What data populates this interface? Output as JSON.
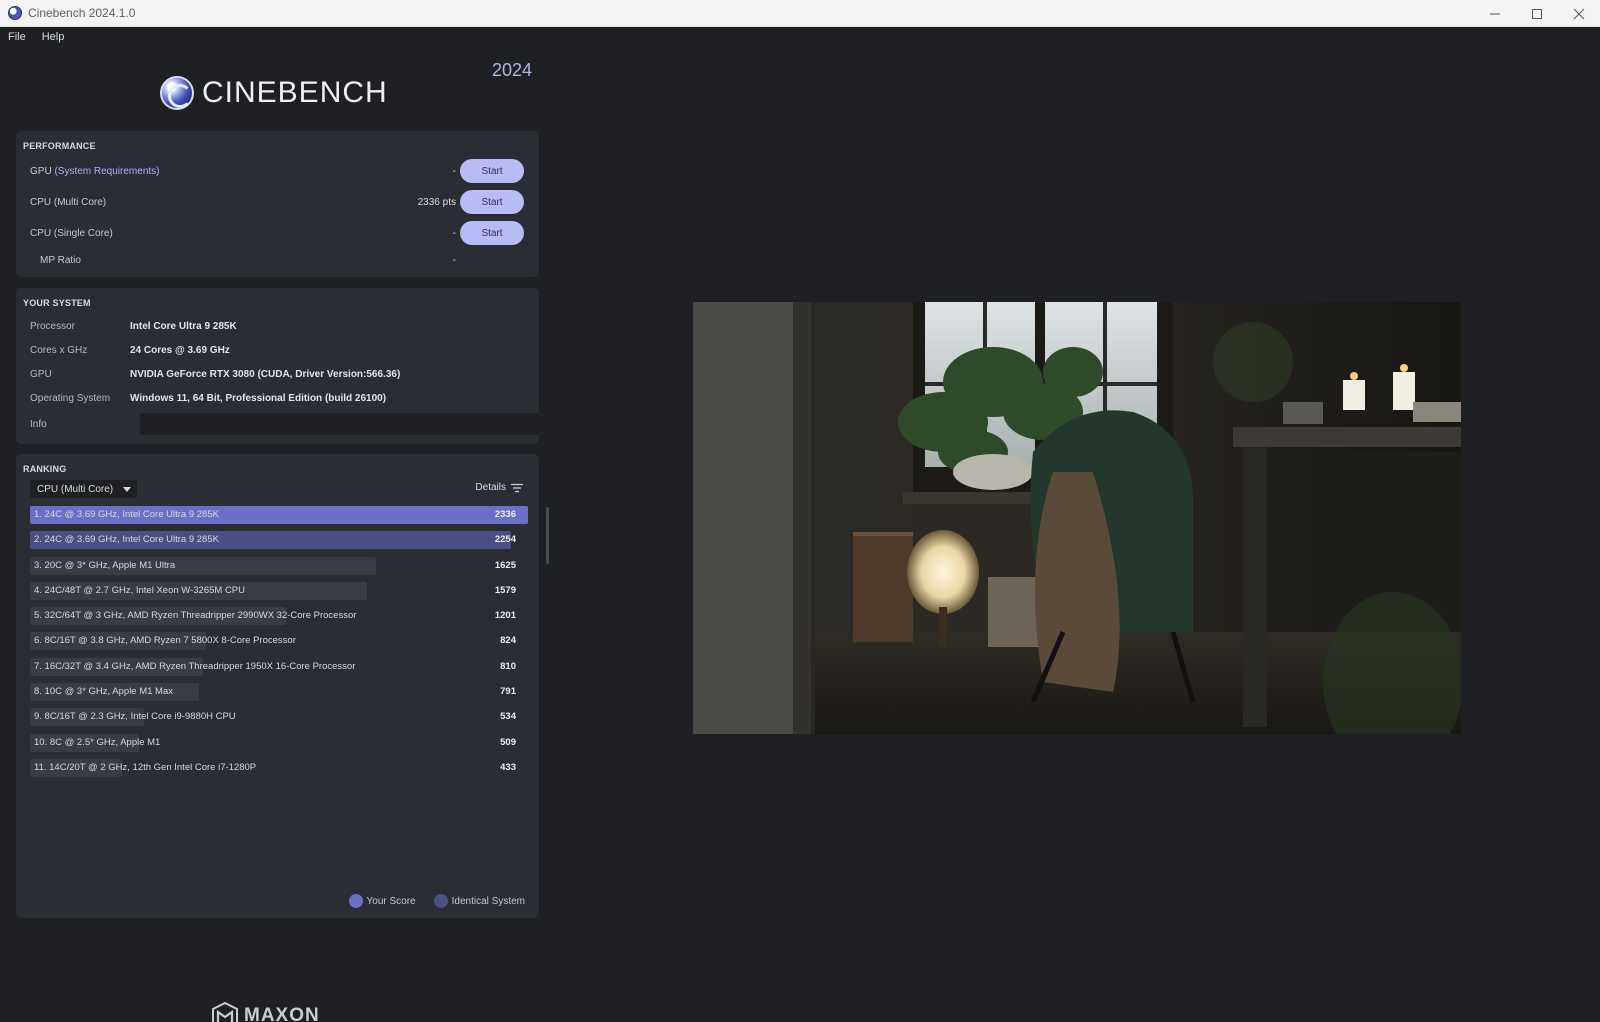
{
  "window": {
    "title": "Cinebench 2024.1.0"
  },
  "menu": {
    "items": [
      "File",
      "Help"
    ]
  },
  "brand": {
    "name": "CINEBENCH",
    "year": "2024",
    "footer": "MAXON"
  },
  "performance": {
    "title": "PERFORMANCE",
    "gpu": {
      "label": "GPU",
      "link": "(System Requirements)",
      "value": "-",
      "button": "Start"
    },
    "cpu_multi": {
      "label": "CPU (Multi Core)",
      "value": "2336 pts",
      "button": "Start"
    },
    "cpu_single": {
      "label": "CPU (Single Core)",
      "value": "-",
      "button": "Start"
    },
    "mp_ratio": {
      "label": "MP Ratio",
      "value": "-"
    }
  },
  "system": {
    "title": "YOUR SYSTEM",
    "rows": [
      {
        "label": "Processor",
        "value": "Intel Core Ultra 9 285K"
      },
      {
        "label": "Cores x GHz",
        "value": "24 Cores @ 3.69 GHz"
      },
      {
        "label": "GPU",
        "value": "NVIDIA GeForce RTX 3080 (CUDA, Driver Version:566.36)"
      },
      {
        "label": "Operating System",
        "value": "Windows 11, 64 Bit, Professional Edition (build 26100)"
      }
    ],
    "info_label": "Info",
    "info_value": ""
  },
  "ranking": {
    "title": "RANKING",
    "selected_mode": "CPU (Multi Core)",
    "details_label": "Details",
    "max_score": 2336,
    "entries": [
      {
        "label": "1. 24C @ 3.69 GHz, Intel Core Ultra 9 285K",
        "score": 2336,
        "kind": "your"
      },
      {
        "label": "2. 24C @ 3.69 GHz, Intel Core Ultra 9 285K",
        "score": 2254,
        "kind": "identical"
      },
      {
        "label": "3. 20C @ 3* GHz, Apple M1 Ultra",
        "score": 1625,
        "kind": "other"
      },
      {
        "label": "4. 24C/48T @ 2.7 GHz, Intel Xeon W-3265M CPU",
        "score": 1579,
        "kind": "other"
      },
      {
        "label": "5. 32C/64T @ 3 GHz, AMD Ryzen Threadripper 2990WX 32-Core Processor",
        "score": 1201,
        "kind": "other"
      },
      {
        "label": "6. 8C/16T @ 3.8 GHz, AMD Ryzen 7 5800X 8-Core Processor",
        "score": 824,
        "kind": "other"
      },
      {
        "label": "7. 16C/32T @ 3.4 GHz, AMD Ryzen Threadripper 1950X 16-Core Processor",
        "score": 810,
        "kind": "other"
      },
      {
        "label": "8. 10C @ 3* GHz, Apple M1 Max",
        "score": 791,
        "kind": "other"
      },
      {
        "label": "9. 8C/16T @ 2.3 GHz, Intel Core i9-9880H CPU",
        "score": 534,
        "kind": "other"
      },
      {
        "label": "10. 8C @ 2.5* GHz, Apple M1",
        "score": 509,
        "kind": "other"
      },
      {
        "label": "11. 14C/20T @ 2 GHz, 12th Gen Intel Core i7-1280P",
        "score": 433,
        "kind": "other"
      }
    ],
    "legend": {
      "your_score": "Your Score",
      "identical": "Identical System"
    }
  },
  "colors": {
    "your_bar": "#6b70c6",
    "identical_bar": "#4b4f86",
    "other_bar": "#3a3c44",
    "accent_button": "#b8bcf5"
  }
}
